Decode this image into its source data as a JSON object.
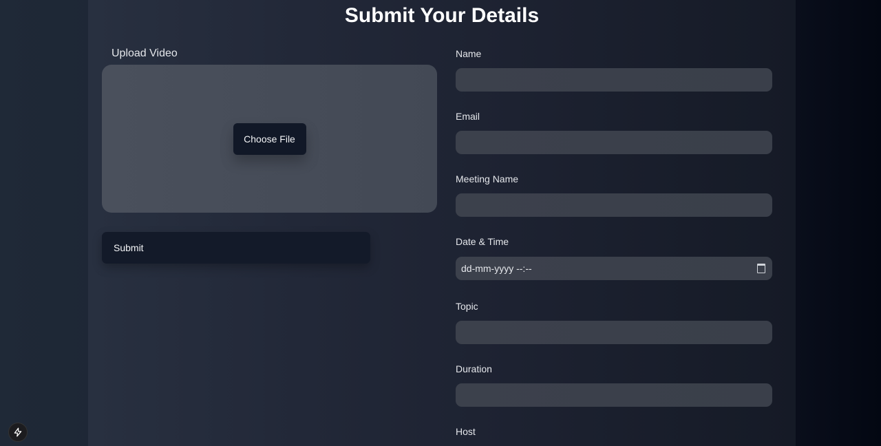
{
  "page": {
    "title": "Submit Your Details"
  },
  "upload": {
    "label": "Upload Video",
    "choose_file_label": "Choose File"
  },
  "submit_label": "Submit",
  "fields": {
    "name": {
      "label": "Name",
      "value": ""
    },
    "email": {
      "label": "Email",
      "value": ""
    },
    "meeting_name": {
      "label": "Meeting Name",
      "value": ""
    },
    "datetime": {
      "label": "Date & Time",
      "placeholder": "dd-mm-yyyy --:--"
    },
    "topic": {
      "label": "Topic",
      "value": ""
    },
    "duration": {
      "label": "Duration",
      "value": ""
    },
    "host": {
      "label": "Host"
    }
  },
  "badge": {
    "icon": "lightning-bolt-icon"
  }
}
